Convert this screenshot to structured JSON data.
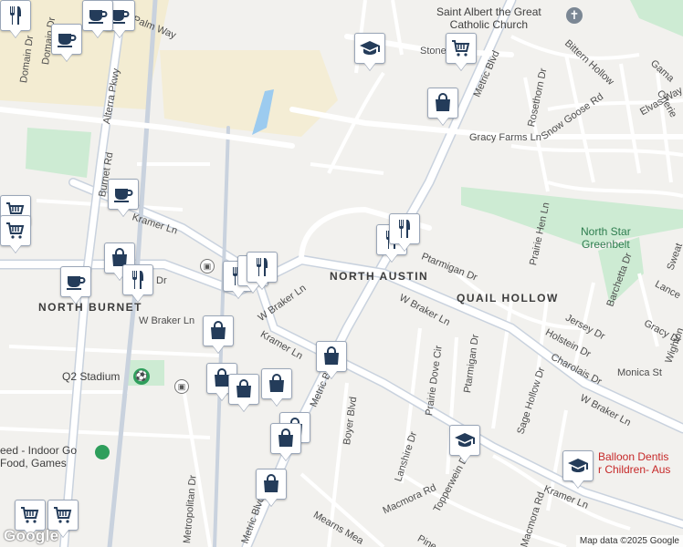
{
  "map": {
    "attribution": "Map data ©2025 Google",
    "logo": "Google"
  },
  "streets": {
    "metric_blvd_north": "Metric Blvd",
    "metric_blvd_mid": "Metric Blvd",
    "metric_blvd_south": "Metric Blvd",
    "braker_east": "W Braker Ln",
    "braker_east_lower": "W Braker Ln",
    "braker_west": "W Braker Ln",
    "braker_west2": "W Braker Ln",
    "kramer_west": "Kramer Ln",
    "kramer_mid": "Kramer Ln",
    "kramer_east": "Kramer Ln",
    "burnet_rd": "Burnet Rd",
    "alterra": "Alterra Pkwy",
    "palm_way": "Palm Way",
    "domain_dr": "Domain Dr",
    "domain_dr2": "Domain Dr",
    "stone": "Stone",
    "gracy_farms": "Gracy Farms Ln",
    "rosethorn": "Rosethorn Dr",
    "snow_goose": "Snow Goose Rd",
    "elvas": "Elvas Way",
    "bittern": "Bittern Hollow",
    "gama": "Gama",
    "cherie": "Cherie",
    "prairie_hen": "Prairie Hen Ln",
    "ptarmigan_dr": "Ptarmigan Dr",
    "ptarmigan_dr2": "Ptarmigan Dr",
    "prairie_dove": "Prairie Dove Cir",
    "jersey": "Jersey Dr",
    "holstein": "Holstein Dr",
    "charolais": "Charolais Dr",
    "monica": "Monica St",
    "gracy_dr": "Gracy Dr",
    "wighton": "Wighton",
    "lance": "Lance",
    "barchetta": "Barchetta Dr",
    "sweat": "Sweat",
    "sage_hollow": "Sage Hollow Dr",
    "lanshire": "Lanshire Dr",
    "topperwein": "Topperwein Dr",
    "macmora_rd": "Macmora Rd",
    "macmora_rd2": "Macmora Rd",
    "boyer": "Boyer Blvd",
    "mearns": "Mearns Mea",
    "pine": "Pine",
    "metropolitan": "Metropolitan Dr",
    "dr_short": "Dr"
  },
  "areas": {
    "north_austin": "NORTH AUSTIN",
    "quail_hollow": "QUAIL HOLLOW",
    "north_burnet": "NORTH BURNET"
  },
  "places": {
    "church_line1": "Saint Albert the Great",
    "church_line2": "Catholic Church",
    "greenbelt_line1": "North Star",
    "greenbelt_line2": "Greenbelt",
    "stadium": "Q2 Stadium",
    "speed_line1": "eed - Indoor Go",
    "speed_line2": "Food, Games",
    "balloon_line1": "Balloon Dentis",
    "balloon_line2": "r Children- Aus"
  },
  "markers": [
    {
      "name": "coffee-marker",
      "icon": "coffee-icon"
    },
    {
      "name": "coffee-marker",
      "icon": "coffee-icon"
    },
    {
      "name": "coffee-marker",
      "icon": "coffee-icon"
    },
    {
      "name": "coffee-marker",
      "icon": "coffee-icon"
    },
    {
      "name": "coffee-marker",
      "icon": "coffee-icon"
    },
    {
      "name": "school-marker",
      "icon": "graduation-cap-icon"
    },
    {
      "name": "school-marker",
      "icon": "graduation-cap-icon"
    },
    {
      "name": "school-marker",
      "icon": "graduation-cap-icon"
    },
    {
      "name": "grocery-marker",
      "icon": "shopping-cart-icon"
    },
    {
      "name": "grocery-marker",
      "icon": "shopping-cart-icon"
    },
    {
      "name": "grocery-marker",
      "icon": "shopping-cart-icon"
    },
    {
      "name": "grocery-marker",
      "icon": "shopping-cart-icon"
    },
    {
      "name": "grocery-marker",
      "icon": "shopping-cart-icon"
    },
    {
      "name": "shopping-marker",
      "icon": "shopping-bag-icon"
    },
    {
      "name": "shopping-marker",
      "icon": "shopping-bag-icon"
    },
    {
      "name": "shopping-marker",
      "icon": "shopping-bag-icon"
    },
    {
      "name": "shopping-marker",
      "icon": "shopping-bag-icon"
    },
    {
      "name": "shopping-marker",
      "icon": "shopping-bag-icon"
    },
    {
      "name": "shopping-marker",
      "icon": "shopping-bag-icon"
    },
    {
      "name": "shopping-marker",
      "icon": "shopping-bag-icon"
    },
    {
      "name": "shopping-marker",
      "icon": "shopping-bag-icon"
    },
    {
      "name": "shopping-marker",
      "icon": "shopping-bag-icon"
    },
    {
      "name": "shopping-marker",
      "icon": "shopping-bag-icon"
    },
    {
      "name": "restaurant-marker",
      "icon": "fork-knife-icon"
    },
    {
      "name": "restaurant-marker",
      "icon": "fork-knife-icon"
    },
    {
      "name": "restaurant-marker",
      "icon": "fork-knife-icon"
    },
    {
      "name": "restaurant-marker",
      "icon": "fork-knife-icon"
    },
    {
      "name": "restaurant-marker",
      "icon": "fork-knife-icon"
    },
    {
      "name": "restaurant-marker",
      "icon": "fork-knife-icon"
    },
    {
      "name": "restaurant-marker",
      "icon": "fork-knife-icon"
    }
  ],
  "colors": {
    "background": "#f2f1ee",
    "road": "#ffffff",
    "highway": "#c9d2de",
    "park": "#cdebd3",
    "commercial": "#f3ecd2",
    "water": "#9ccbef",
    "marker_icon": "#243c5a"
  }
}
